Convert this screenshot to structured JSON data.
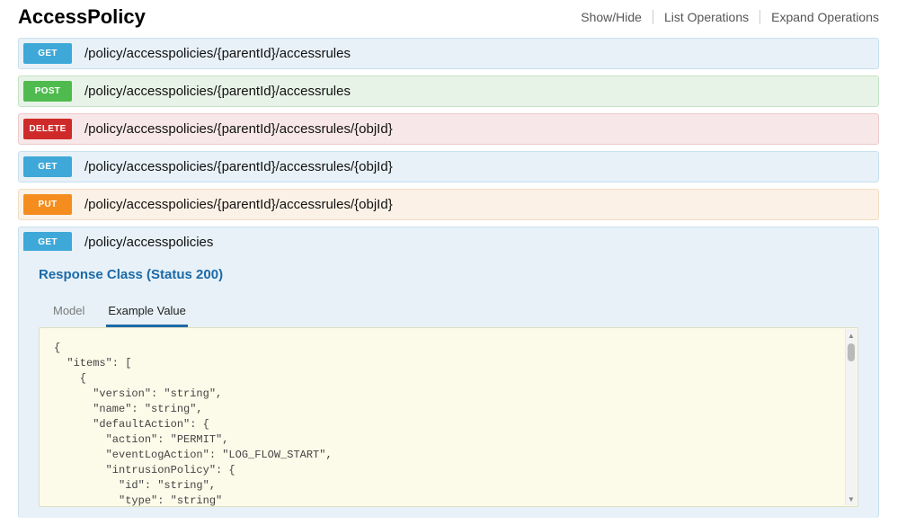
{
  "resourceTitle": "AccessPolicy",
  "headerActions": {
    "showHide": "Show/Hide",
    "listOps": "List Operations",
    "expandOps": "Expand Operations"
  },
  "operations": [
    {
      "method": "GET",
      "path": "/policy/accesspolicies/{parentId}/accessrules"
    },
    {
      "method": "POST",
      "path": "/policy/accesspolicies/{parentId}/accessrules"
    },
    {
      "method": "DELETE",
      "path": "/policy/accesspolicies/{parentId}/accessrules/{objId}"
    },
    {
      "method": "GET",
      "path": "/policy/accesspolicies/{parentId}/accessrules/{objId}"
    },
    {
      "method": "PUT",
      "path": "/policy/accesspolicies/{parentId}/accessrules/{objId}"
    },
    {
      "method": "GET",
      "path": "/policy/accesspolicies"
    }
  ],
  "expanded": {
    "responseHeading": "Response Class (Status 200)",
    "tabs": {
      "model": "Model",
      "example": "Example Value"
    },
    "exampleJson": "{\n  \"items\": [\n    {\n      \"version\": \"string\",\n      \"name\": \"string\",\n      \"defaultAction\": {\n        \"action\": \"PERMIT\",\n        \"eventLogAction\": \"LOG_FLOW_START\",\n        \"intrusionPolicy\": {\n          \"id\": \"string\",\n          \"type\": \"string\""
  }
}
